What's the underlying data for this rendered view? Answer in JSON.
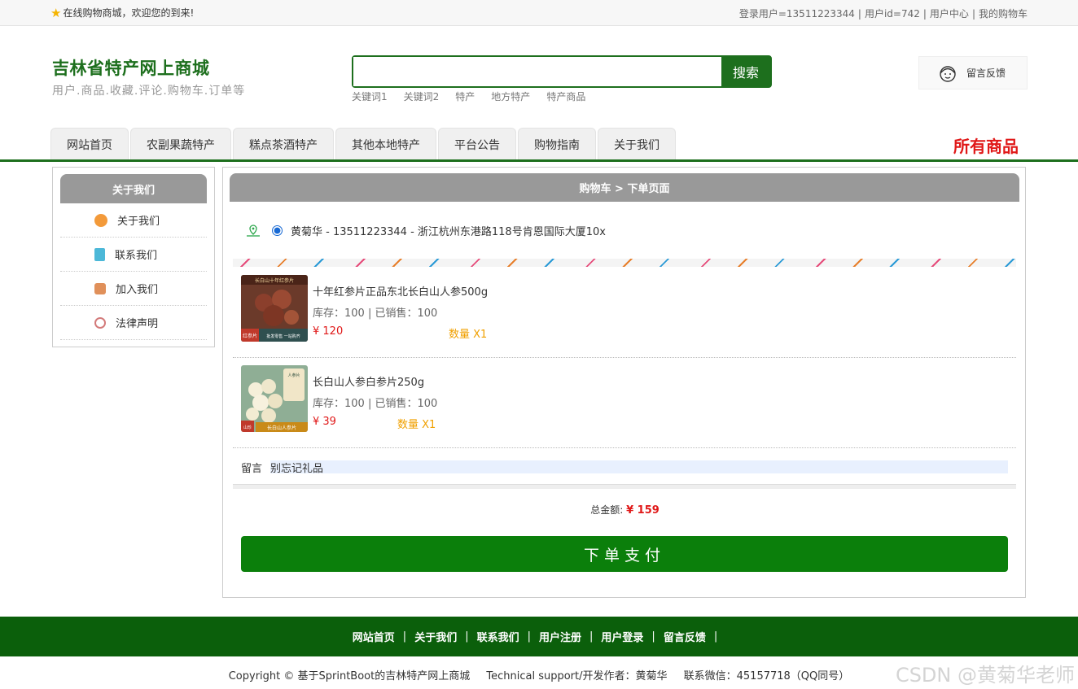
{
  "topbar": {
    "welcome": "在线购物商城，欢迎您的到来!",
    "links": [
      "登录用户=13511223344",
      "用户id=742",
      "用户中心",
      "我的购物车"
    ]
  },
  "header": {
    "title": "吉林省特产网上商城",
    "subtitle": "用户.商品.收藏.评论.购物车.订单等",
    "search_placeholder": "",
    "search_button": "搜索",
    "keywords": [
      "关键词1",
      "关键词2",
      "特产",
      "地方特产",
      "特产商品"
    ],
    "feedback": "留言反馈"
  },
  "nav": {
    "tabs": [
      "网站首页",
      "农副果蔬特产",
      "糕点茶酒特产",
      "其他本地特产",
      "平台公告",
      "购物指南",
      "关于我们"
    ],
    "all_goods": "所有商品"
  },
  "sidebar": {
    "title": "关于我们",
    "items": [
      {
        "label": "关于我们",
        "icon": "orange-circle-icon",
        "color": "#f39a3a"
      },
      {
        "label": "联系我们",
        "icon": "clipboard-icon",
        "color": "#4cb8d8"
      },
      {
        "label": "加入我们",
        "icon": "lock-icon",
        "color": "#e0905a"
      },
      {
        "label": "法律声明",
        "icon": "power-icon",
        "color": "#d37a7a"
      }
    ]
  },
  "order": {
    "breadcrumb": "购物车 > 下单页面",
    "address": "黄菊华 - 13511223344 - 浙江杭州东港路118号肯恩国际大厦10x",
    "items": [
      {
        "name": "十年红参片正品东北长白山人参500g",
        "stock": "库存：100 | 已销售：100",
        "price": "¥ 120",
        "qty": "数量 X1",
        "pic_badge": "红参片",
        "pic_banner": "批发零售 一站购齐",
        "pic_top": "长白山十年红参片"
      },
      {
        "name": "长白山人参白参片250g",
        "stock": "库存：100 | 已销售：100",
        "price": "¥ 39",
        "qty": "数量 X1",
        "pic_badge": "山珍",
        "pic_banner": "长白山人参片",
        "pic_top": "人参片"
      }
    ],
    "message_label": "留言",
    "message_value": "别忘记礼品",
    "total_label": "总金额:",
    "total_value": "¥ 159",
    "pay_button": "下单支付"
  },
  "footer": {
    "links": [
      "网站首页",
      "关于我们",
      "联系我们",
      "用户注册",
      "用户登录",
      "留言反馈"
    ],
    "copyright": "Copyright © 基于SprintBoot的吉林特产网上商城",
    "support": "Technical support/开发作者：黄菊华",
    "contact": "联系微信：45157718（QQ同号）",
    "watermark": "CSDN @黄菊华老师"
  },
  "colors": {
    "brand_green": "#1d6f1d",
    "price_red": "#e01818",
    "qty_orange": "#f0a000",
    "pay_green": "#0b7f0b"
  }
}
